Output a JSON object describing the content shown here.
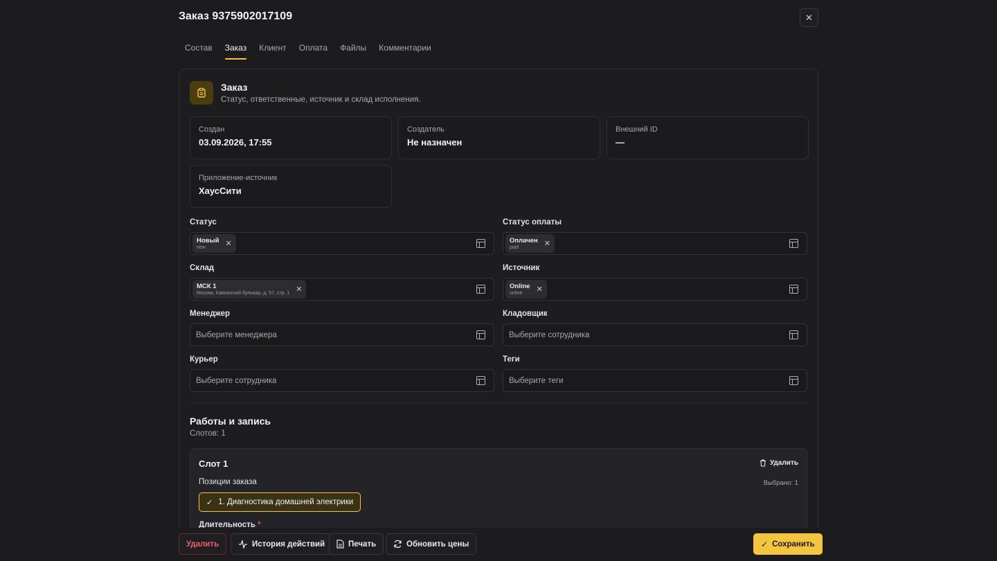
{
  "header": {
    "title": "Заказ 9375902017109"
  },
  "tabs": [
    "Состав",
    "Заказ",
    "Клиент",
    "Оплата",
    "Файлы",
    "Комментарии"
  ],
  "active_tab": "Заказ",
  "section": {
    "title": "Заказ",
    "subtitle": "Статус, ответственные, источник и склад исполнения."
  },
  "info": {
    "created": {
      "label": "Создан",
      "value": "03.09.2026, 17:55"
    },
    "creator": {
      "label": "Создатель",
      "value": "Не назначен"
    },
    "external": {
      "label": "Внешний ID",
      "value": "—"
    },
    "source_app": {
      "label": "Приложение-источник",
      "value": "ХаусСити"
    }
  },
  "fields": {
    "status": {
      "label": "Статус",
      "chip": "Новый",
      "chip_sub": "new"
    },
    "pay_status": {
      "label": "Статус оплаты",
      "chip": "Оплачен",
      "chip_sub": "paid"
    },
    "warehouse": {
      "label": "Склад",
      "chip": "МСК 1",
      "chip_sub": "Москва, Кавказский бульвар, д. 57, стр. 1"
    },
    "source": {
      "label": "Источник",
      "chip": "Online",
      "chip_sub": "online"
    },
    "manager": {
      "label": "Менеджер",
      "placeholder": "Выберите менеджера"
    },
    "storekeeper": {
      "label": "Кладовщик",
      "placeholder": "Выберите сотрудника"
    },
    "courier": {
      "label": "Курьер",
      "placeholder": "Выберите сотрудника"
    },
    "tags": {
      "label": "Теги",
      "placeholder": "Выберите теги"
    }
  },
  "works": {
    "title": "Работы и запись",
    "slots_count": "Слотов: 1",
    "slot": {
      "title": "Слот 1",
      "delete": "Удалить",
      "positions_label": "Позиции заказа",
      "selected": "Выбрано: 1",
      "position": "1. Диагностика домашней электрики",
      "duration_label": "Длительность",
      "required": "*"
    }
  },
  "footer": {
    "delete": "Удалить",
    "history": "История действий",
    "print": "Печать",
    "refresh": "Обновить цены",
    "save": "Сохранить"
  },
  "colors": {
    "accent": "#f5c542",
    "danger": "#f25f5f",
    "background": "#1c1c1f"
  }
}
